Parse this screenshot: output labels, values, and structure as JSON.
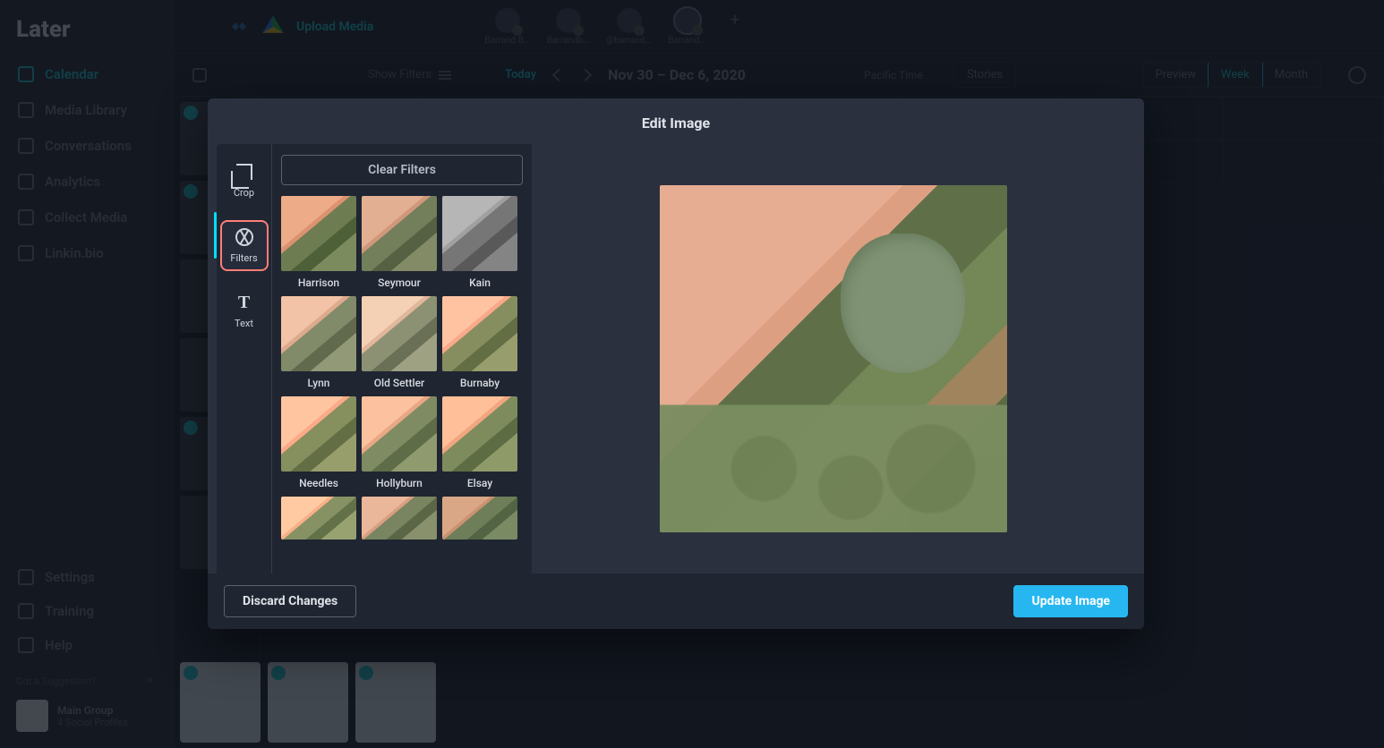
{
  "app": {
    "logo_text": "Later"
  },
  "sidebar": {
    "items": [
      {
        "label": "Calendar"
      },
      {
        "label": "Media Library"
      },
      {
        "label": "Conversations"
      },
      {
        "label": "Analytics"
      },
      {
        "label": "Collect Media"
      },
      {
        "label": "Linkin.bio"
      }
    ],
    "bottom": [
      {
        "label": "Settings"
      },
      {
        "label": "Training"
      },
      {
        "label": "Help"
      }
    ],
    "suggestion_label": "Got a Suggestion?",
    "group": {
      "name": "Main Group",
      "profiles": "4 Social Profiles"
    }
  },
  "topbar": {
    "upload_label": "Upload Media",
    "accounts": [
      {
        "label": "Barrand B..."
      },
      {
        "label": "Barrandb..."
      },
      {
        "label": "@barrand..."
      },
      {
        "label": "Barrand..."
      }
    ]
  },
  "calendar_toolbar": {
    "show_filters": "Show Filters",
    "today": "Today",
    "date_range": "Nov 30 – Dec 6, 2020",
    "timezone": "Pacific Time",
    "views": {
      "stories": "Stories",
      "preview": "Preview",
      "week": "Week",
      "month": "Month"
    }
  },
  "modal": {
    "title": "Edit Image",
    "tools": {
      "crop": "Crop",
      "filters": "Filters",
      "text": "Text"
    },
    "clear_filters": "Clear Filters",
    "filters": [
      {
        "name": "Harrison",
        "class": "harrison"
      },
      {
        "name": "Seymour",
        "class": "seymour"
      },
      {
        "name": "Kain",
        "class": "kain"
      },
      {
        "name": "Lynn",
        "class": "lynn"
      },
      {
        "name": "Old Settler",
        "class": "oldsettler"
      },
      {
        "name": "Burnaby",
        "class": "burnaby"
      },
      {
        "name": "Needles",
        "class": "needles"
      },
      {
        "name": "Hollyburn",
        "class": "hollyburn"
      },
      {
        "name": "Elsay",
        "class": "elsay"
      }
    ],
    "discard": "Discard Changes",
    "update": "Update Image"
  }
}
